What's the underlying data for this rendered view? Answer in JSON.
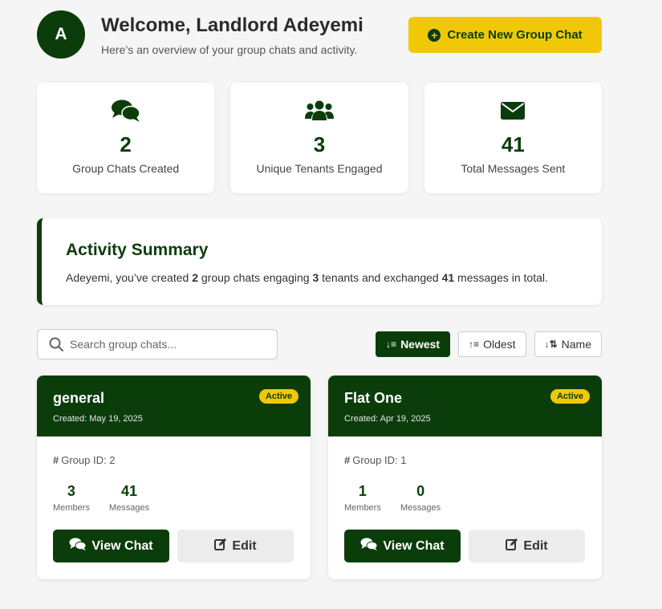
{
  "header": {
    "avatar_initial": "A",
    "title": "Welcome, Landlord Adeyemi",
    "subtitle": "Here’s an overview of your group chats and activity.",
    "create_button": "Create New Group Chat"
  },
  "stats": [
    {
      "icon": "chat-bubbles-icon",
      "value": "2",
      "label": "Group Chats Created"
    },
    {
      "icon": "users-icon",
      "value": "3",
      "label": "Unique Tenants Engaged"
    },
    {
      "icon": "envelope-icon",
      "value": "41",
      "label": "Total Messages Sent"
    }
  ],
  "summary": {
    "title": "Activity Summary",
    "text_1": "Adeyemi, you’ve created ",
    "chats": "2",
    "text_2": " group chats engaging ",
    "tenants": "3",
    "text_3": " tenants and exchanged ",
    "messages": "41",
    "text_4": " messages in total."
  },
  "search": {
    "placeholder": "Search group chats..."
  },
  "sort": {
    "newest": "Newest",
    "oldest": "Oldest",
    "name": "Name",
    "active": "newest"
  },
  "groups": [
    {
      "name": "general",
      "created": "Created: May 19, 2025",
      "status": "Active",
      "group_id": "Group ID: 2",
      "members": "3",
      "members_label": "Members",
      "messages": "41",
      "messages_label": "Messages",
      "view_label": "View Chat",
      "edit_label": "Edit"
    },
    {
      "name": "Flat One",
      "created": "Created: Apr 19, 2025",
      "status": "Active",
      "group_id": "Group ID: 1",
      "members": "1",
      "members_label": "Members",
      "messages": "0",
      "messages_label": "Messages",
      "view_label": "View Chat",
      "edit_label": "Edit"
    }
  ],
  "colors": {
    "primary": "#0b3d0b",
    "accent": "#f0c808",
    "background": "#f5f5f5"
  }
}
